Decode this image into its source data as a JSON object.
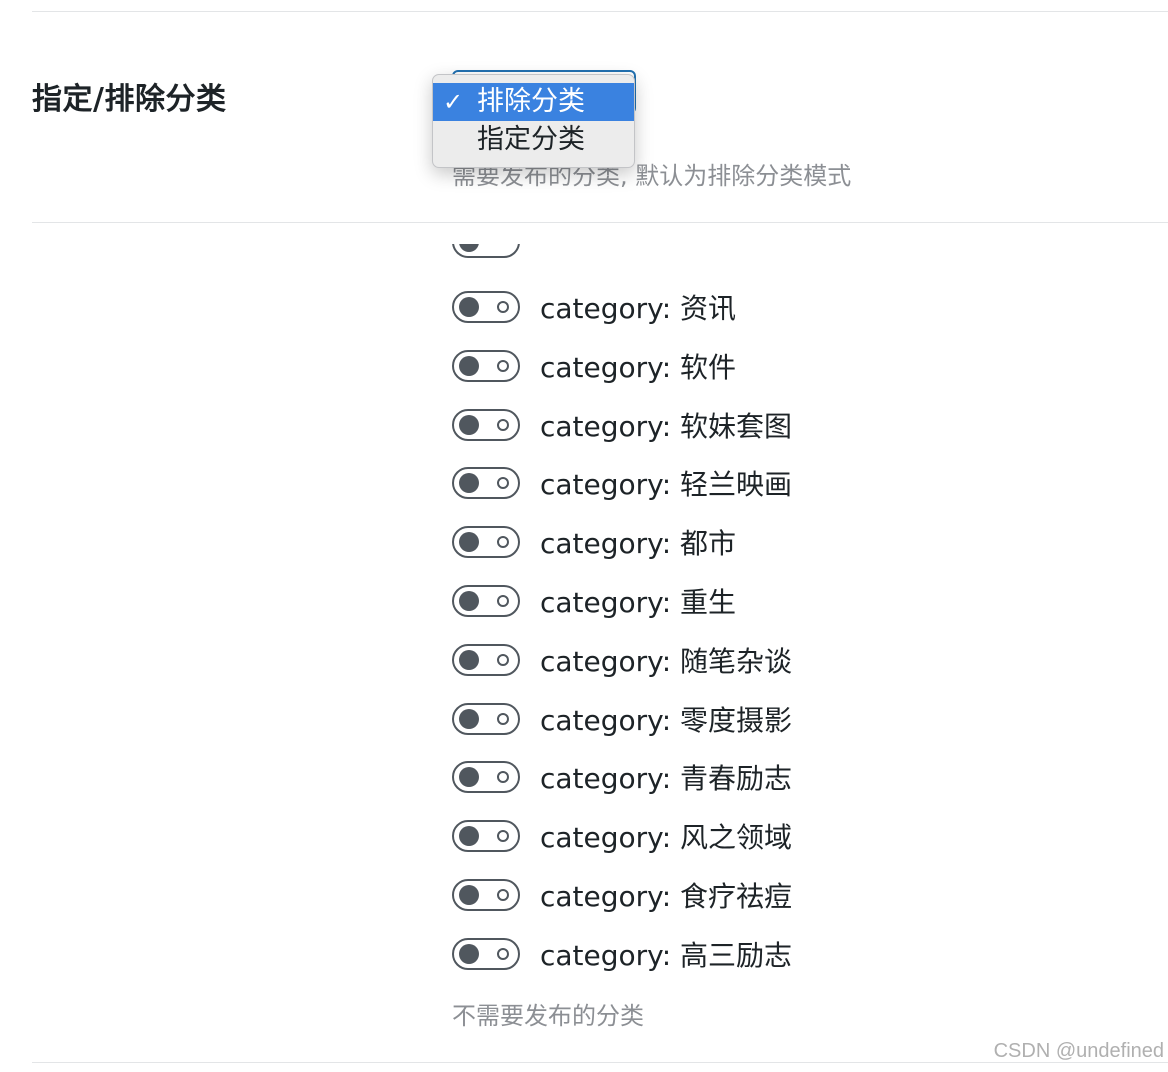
{
  "setting": {
    "label": "指定/排除分类",
    "description": "需要发布的分类, 默认为排除分类模式"
  },
  "dropdown": {
    "check_icon": "✓",
    "options": [
      {
        "label": "排除分类",
        "selected": true
      },
      {
        "label": "指定分类",
        "selected": false
      }
    ]
  },
  "categories": [
    {
      "label": "category: 资讯",
      "enabled": false
    },
    {
      "label": "category: 软件",
      "enabled": false
    },
    {
      "label": "category: 软妹套图",
      "enabled": false
    },
    {
      "label": "category: 轻兰映画",
      "enabled": false
    },
    {
      "label": "category: 都市",
      "enabled": false
    },
    {
      "label": "category: 重生",
      "enabled": false
    },
    {
      "label": "category: 随笔杂谈",
      "enabled": false
    },
    {
      "label": "category: 零度摄影",
      "enabled": false
    },
    {
      "label": "category: 青春励志",
      "enabled": false
    },
    {
      "label": "category: 风之领域",
      "enabled": false
    },
    {
      "label": "category: 食疗祛痘",
      "enabled": false
    },
    {
      "label": "category: 高三励志",
      "enabled": false
    }
  ],
  "exclude_description": "不需要发布的分类",
  "watermark": "CSDN @undefined",
  "colors": {
    "accent": "#3a82e0",
    "toggle": "#50575e",
    "muted_text": "#8c8f94"
  }
}
